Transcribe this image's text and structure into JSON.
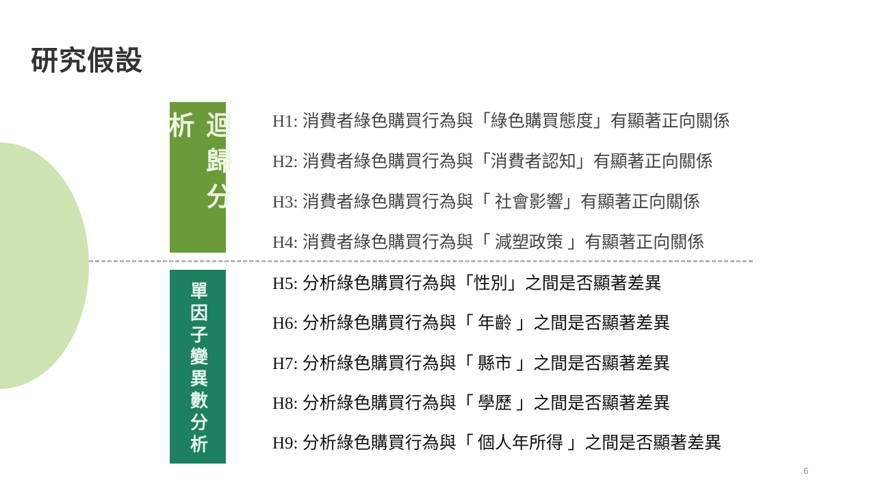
{
  "title": "研究假設",
  "groups": [
    {
      "label": "迴歸分析",
      "color": "#6b9a3b"
    },
    {
      "label": "單因子變異數分析",
      "color": "#1d8060"
    }
  ],
  "hypotheses": [
    "H1: 消費者綠色購買行為與「綠色購買態度」有顯著正向關係",
    "H2: 消費者綠色購買行為與「消費者認知」有顯著正向關係",
    "H3: 消費者綠色購買行為與「 社會影響」有顯著正向關係",
    "H4: 消費者綠色購買行為與「 減塑政策 」有顯著正向關係",
    "H5: 分析綠色購買行為與「性別」之間是否顯著差異",
    "H6: 分析綠色購買行為與「 年齡 」之間是否顯著差異",
    "H7: 分析綠色購買行為與「 縣市 」之間是否顯著差異",
    "H8: 分析綠色購買行為與「 學歷 」之間是否顯著差異",
    "H9: 分析綠色購買行為與「 個人年所得 」之間是否顯著差異"
  ],
  "page_number": "6"
}
